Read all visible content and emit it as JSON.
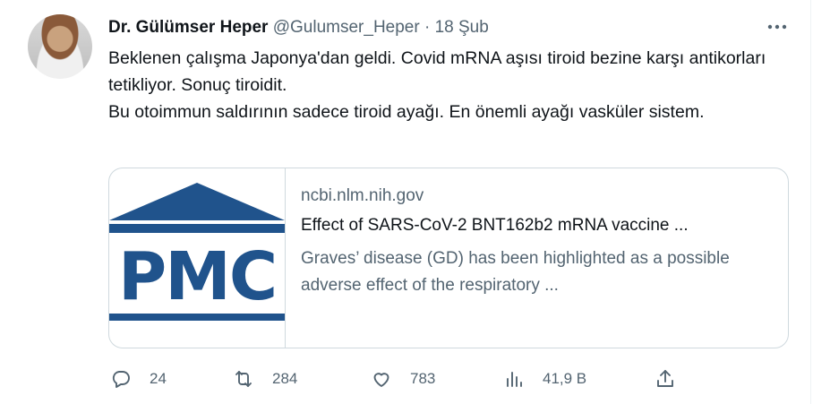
{
  "tweet": {
    "author_name": "Dr. Gülümser Heper",
    "handle": "@Gulumser_Heper",
    "separator": "·",
    "date": "18 Şub",
    "text_lines": [
      "Beklenen çalışma Japonya'dan geldi. Covid mRNA aşısı tiroid bezine karşı antikorları tetikliyor. Sonuç tiroidit.",
      "Bu otoimmun saldırının sadece tiroid ayağı. En önemli ayağı vasküler sistem."
    ]
  },
  "card": {
    "logo_text": "PMC",
    "domain": "ncbi.nlm.nih.gov",
    "title": "Effect of SARS-CoV-2 BNT162b2 mRNA vaccine ...",
    "description": "Graves’ disease (GD) has been highlighted as a possible adverse effect of the respiratory ...",
    "logo_color": "#20538c"
  },
  "actions": {
    "replies": "24",
    "retweets": "284",
    "likes": "783",
    "views": "41,9 B"
  },
  "icons": [
    "more-icon",
    "reply-icon",
    "retweet-icon",
    "like-icon",
    "views-icon",
    "share-icon"
  ]
}
